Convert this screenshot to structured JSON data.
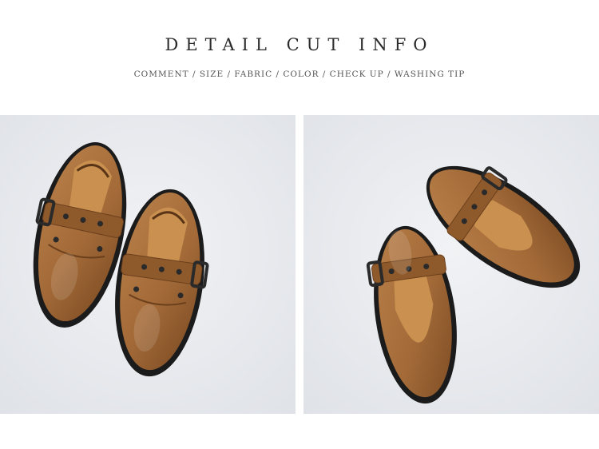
{
  "header": {
    "title": "DETAIL CUT INFO",
    "subtitle": "COMMENT / SIZE / FABRIC / COLOR / CHECK UP / WASHING TIP"
  },
  "photos": [
    {
      "subject": "pair-of-brown-leather-buckle-shoes-top-view"
    },
    {
      "subject": "pair-of-brown-leather-buckle-shoes-angled-view"
    }
  ],
  "colors": {
    "background": "#e9ebef",
    "leather": "#a86f3f",
    "leather_dark": "#7c4b23",
    "lining": "#c9904f",
    "sole": "#1c1c1c",
    "title_text": "#2b2b2b"
  }
}
